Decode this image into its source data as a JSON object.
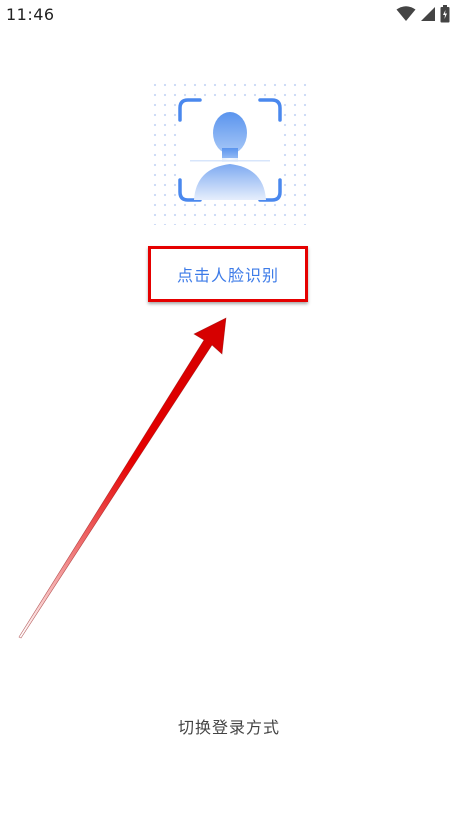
{
  "status_bar": {
    "time": "11:46",
    "icons": [
      "wifi-icon",
      "signal-icon",
      "battery-icon"
    ]
  },
  "face_recognition": {
    "icon": "face-scan-icon",
    "label": "点击人脸识别",
    "accent_color": "#3d7be8"
  },
  "annotation": {
    "highlight_color": "#e50000",
    "arrow_color": "#e50000"
  },
  "footer": {
    "switch_login_label": "切换登录方式"
  }
}
